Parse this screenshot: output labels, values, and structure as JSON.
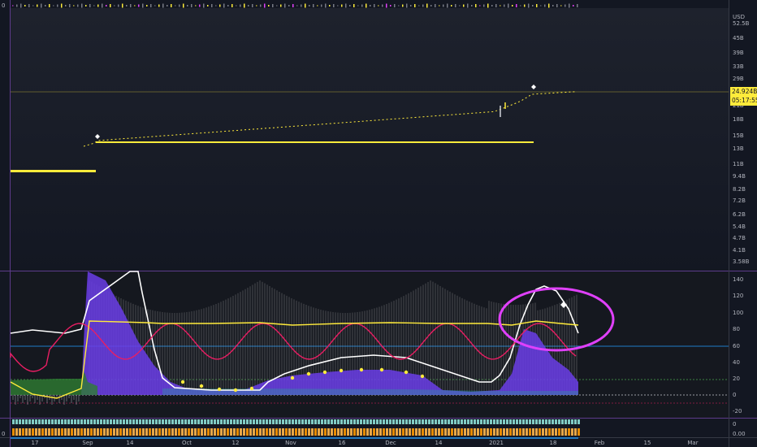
{
  "currency": "USD",
  "price_labels": [
    "52.5B",
    "45B",
    "39B",
    "33B",
    "29B",
    "21B",
    "18B",
    "15B",
    "13B",
    "11B",
    "9.4B",
    "8.2B",
    "7.2B",
    "6.2B",
    "5.4B",
    "4.7B",
    "4.1B",
    "3.58B"
  ],
  "osc_labels": [
    "140",
    "120",
    "100",
    "80",
    "60",
    "40",
    "20",
    "0",
    "-20"
  ],
  "strip_labels": [
    "0",
    "0.00"
  ],
  "left_labels": [
    "0",
    "0"
  ],
  "x_labels": [
    "17",
    "Sep",
    "14",
    "Oct",
    "12",
    "Nov",
    "16",
    "Dec",
    "14",
    "2021",
    "18",
    "Feb",
    "15",
    "Mar"
  ],
  "last_value": "24.924B",
  "countdown": "05:17:55",
  "colors": {
    "background": "#131722",
    "price_line": "#ffeb3b",
    "oscillator_fill": "#6a3de8",
    "red_line": "#e91e63",
    "white_line": "#ffffff",
    "annotation_ellipse": "#e040fb",
    "teal_bars": "#26a69a",
    "blue_line": "#2196f3"
  }
}
